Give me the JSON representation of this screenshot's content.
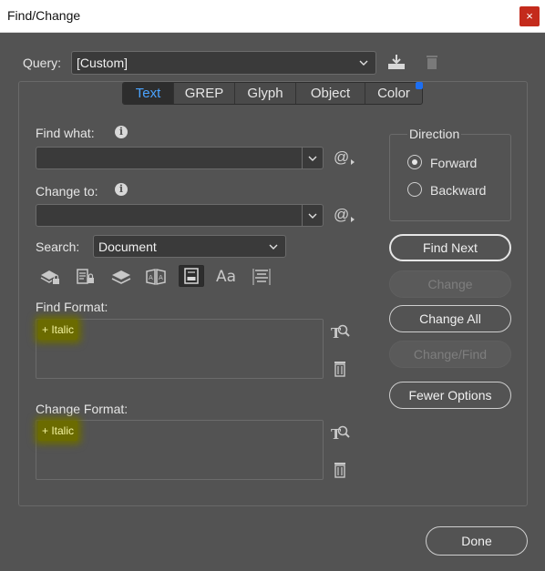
{
  "window": {
    "title": "Find/Change",
    "close_label": "×"
  },
  "query": {
    "label": "Query:",
    "value": "[Custom]"
  },
  "tabs": [
    {
      "label": "Text",
      "active": true
    },
    {
      "label": "GREP",
      "active": false
    },
    {
      "label": "Glyph",
      "active": false
    },
    {
      "label": "Object",
      "active": false
    },
    {
      "label": "Color",
      "active": false
    }
  ],
  "find_what": {
    "label": "Find what:",
    "value": ""
  },
  "change_to": {
    "label": "Change to:",
    "value": ""
  },
  "search": {
    "label": "Search:",
    "value": "Document"
  },
  "find_format": {
    "label": "Find Format:",
    "value": "+ Italic"
  },
  "change_format": {
    "label": "Change Format:",
    "value": "+ Italic"
  },
  "direction": {
    "title": "Direction",
    "forward": "Forward",
    "backward": "Backward",
    "selected": "Forward"
  },
  "buttons": {
    "find_next": "Find Next",
    "change": "Change",
    "change_all": "Change All",
    "change_find": "Change/Find",
    "fewer_options": "Fewer Options",
    "done": "Done"
  },
  "colors": {
    "accent": "#4aa3ff",
    "dialog_bg": "#535353",
    "highlight": "#6b6b00"
  }
}
